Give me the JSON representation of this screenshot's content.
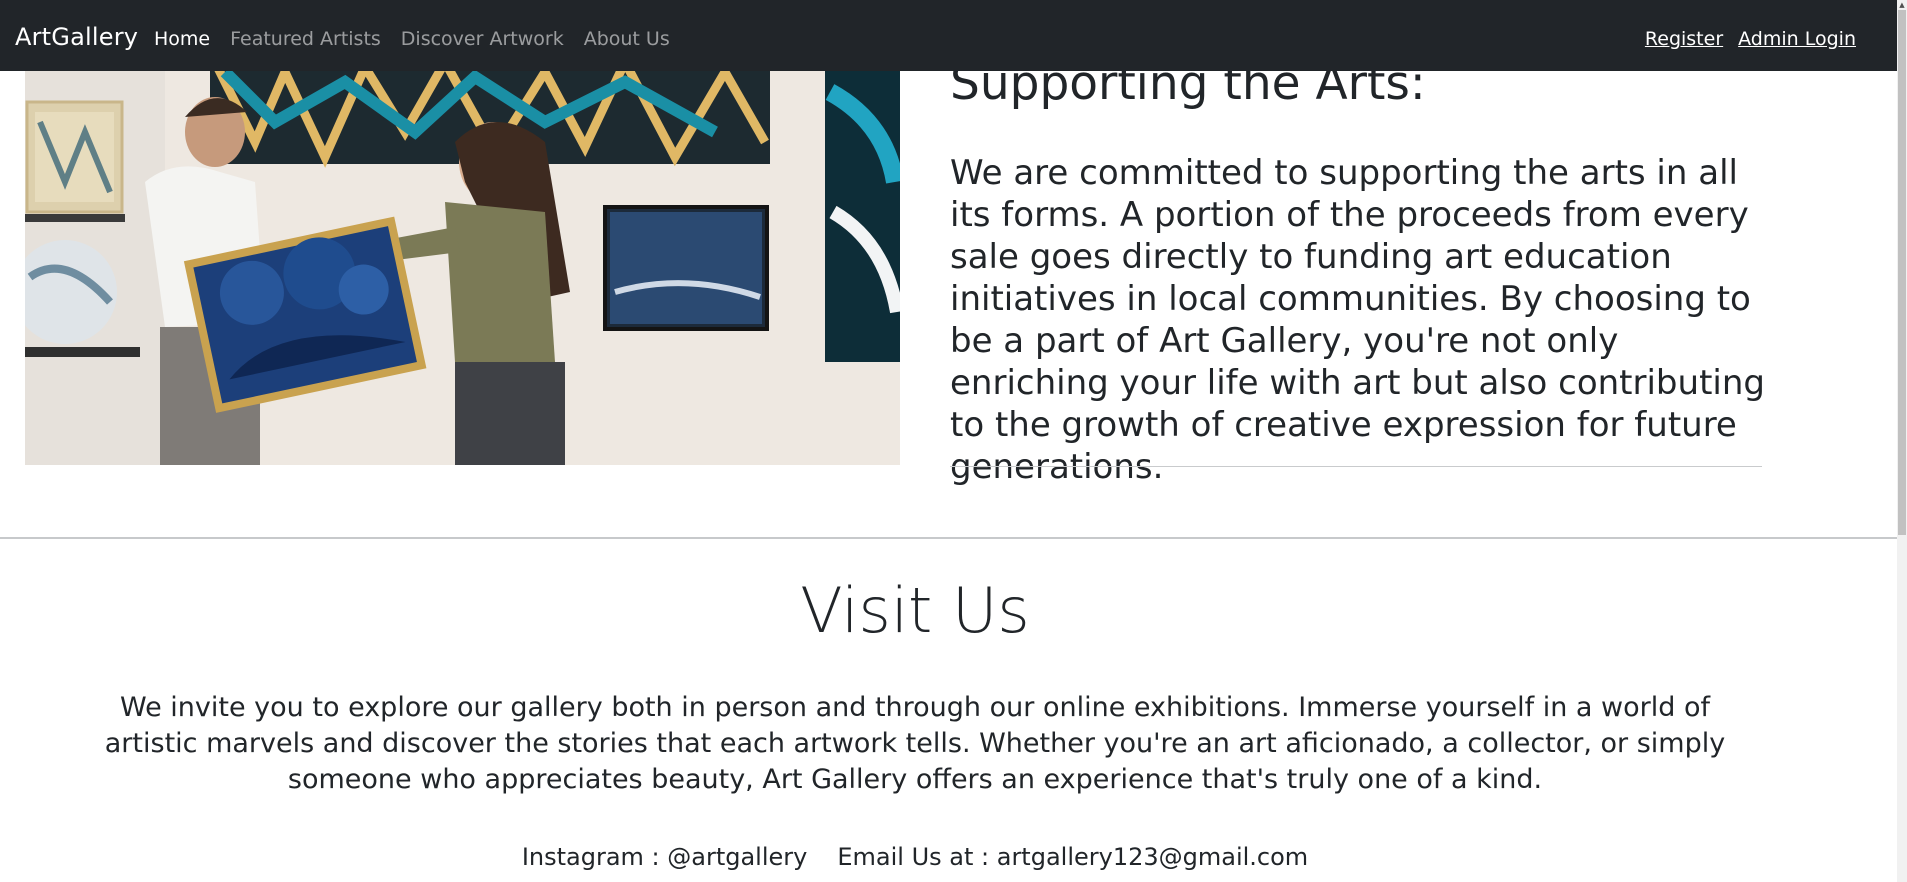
{
  "navbar": {
    "brand": "ArtGallery",
    "links": [
      "Home",
      "Featured Artists",
      "Discover Artwork",
      "About Us"
    ],
    "register": "Register",
    "admin_login": "Admin Login"
  },
  "support": {
    "title": "Supporting the Arts:",
    "text": "We are committed to supporting the arts in all its forms. A portion of the proceeds from every sale goes directly to funding art education initiatives in local communities. By choosing to be a part of Art Gallery, you're not only enriching your life with art but also contributing to the growth of creative expression for future generations."
  },
  "visit": {
    "title": "Visit Us",
    "text": "We invite you to explore our gallery both in person and through our online exhibitions. Immerse yourself in a world of artistic marvels and discover the stories that each artwork tells. Whether you're an art aficionado, a collector, or simply someone who appreciates beauty, Art Gallery offers an experience that's truly one of a kind.",
    "instagram": "Instagram : @artgallery",
    "email": "Email Us at : artgallery123@gmail.com"
  },
  "colors": {
    "navbar_bg": "#212529",
    "text": "#212529",
    "nav_muted": "rgba(255,255,255,0.55)"
  },
  "icons": {
    "scroll_up": "scroll-up-arrow-icon"
  }
}
